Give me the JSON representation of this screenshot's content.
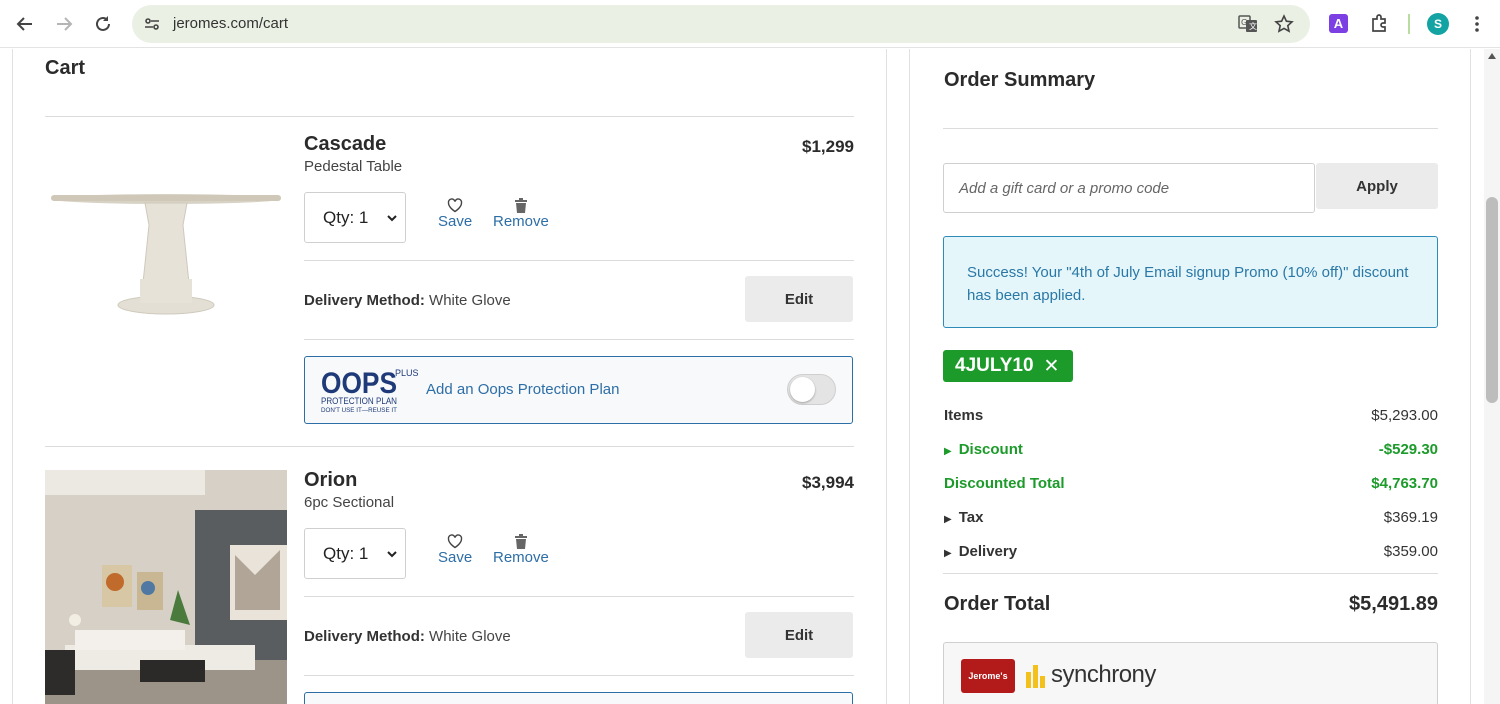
{
  "browser": {
    "url": "jeromes.com/cart",
    "profile_initial": "S",
    "extension_letter": "A",
    "icons": [
      "back-icon",
      "forward-icon",
      "reload-icon",
      "site-info-icon",
      "translate-icon",
      "star-icon",
      "extension-a-icon",
      "puzzle-icon",
      "avatar",
      "menu-icon"
    ]
  },
  "cart": {
    "title": "Cart",
    "items": [
      {
        "name": "Cascade",
        "subtitle": "Pedestal Table",
        "price": "$1,299",
        "qty": "Qty: 1",
        "save_label": "Save",
        "remove_label": "Remove",
        "delivery_label": "Delivery Method:",
        "delivery_value": "White Glove",
        "edit_label": "Edit",
        "protection_text": "Add an Oops Protection Plan",
        "protection_on": false
      },
      {
        "name": "Orion",
        "subtitle": "6pc Sectional",
        "price": "$3,994",
        "qty": "Qty: 1",
        "save_label": "Save",
        "remove_label": "Remove",
        "delivery_label": "Delivery Method:",
        "delivery_value": "White Glove",
        "edit_label": "Edit"
      }
    ],
    "oops_logo": {
      "main": "OOPS",
      "plus": "PLUS",
      "line1": "PROTECTION PLAN",
      "line2": "DON'T USE IT—REUSE IT"
    }
  },
  "summary": {
    "title": "Order Summary",
    "promo_placeholder": "Add a gift card or a promo code",
    "apply_label": "Apply",
    "success_message": "Success! Your \"4th of July Email signup Promo (10% off)\" discount has been applied.",
    "coupon_code": "4JULY10",
    "coupon_remove": "✕",
    "rows": [
      {
        "label": "Items",
        "value": "$5,293.00"
      },
      {
        "label": "Discount",
        "value": "-$529.30"
      },
      {
        "label": "Discounted Total",
        "value": "$4,763.70"
      },
      {
        "label": "Tax",
        "value": "$369.19"
      },
      {
        "label": "Delivery",
        "value": "$359.00"
      }
    ],
    "total_label": "Order Total",
    "total_value": "$5,491.89",
    "financing": {
      "card_text": "Jerome's",
      "brand": "synchrony"
    }
  },
  "colors": {
    "link_blue": "#2e6ea6",
    "success_green": "#1c9b2a",
    "success_bg": "#e5f6fb",
    "card_red": "#b31b1b"
  }
}
